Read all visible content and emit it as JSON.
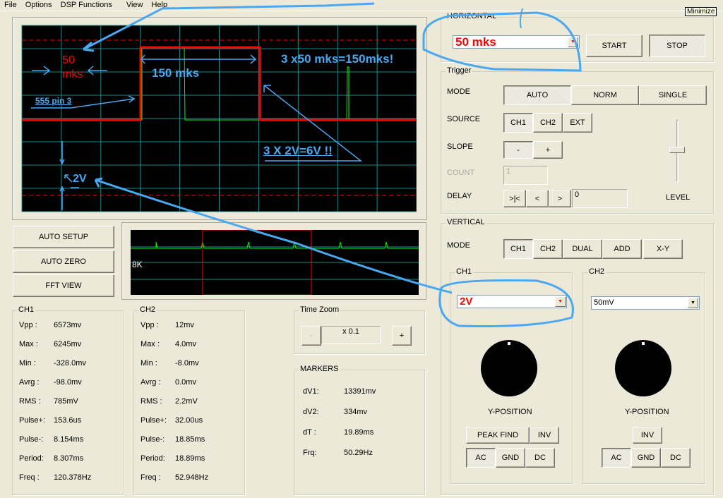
{
  "menu": [
    "File",
    "Options",
    "DSP Functions",
    "View",
    "Help"
  ],
  "tooltip": "Minimize",
  "horizontal": {
    "title": "HORIZONTAL",
    "timebase": "50 mks",
    "start": "START",
    "stop": "STOP"
  },
  "trigger": {
    "title": "Trigger",
    "mode_label": "MODE",
    "modes": [
      "AUTO",
      "NORM",
      "SINGLE"
    ],
    "source_label": "SOURCE",
    "sources": [
      "CH1",
      "CH2",
      "EXT"
    ],
    "slope_label": "SLOPE",
    "slopes": [
      "-",
      "+"
    ],
    "count_label": "COUNT",
    "count_value": "1",
    "delay_label": "DELAY",
    "delay_buttons": [
      ">|<",
      "<",
      ">"
    ],
    "delay_value": "0",
    "level_label": "LEVEL"
  },
  "vertical": {
    "title": "VERTICAL",
    "mode_label": "MODE",
    "modes": [
      "CH1",
      "CH2",
      "DUAL",
      "ADD",
      "X-Y"
    ],
    "ch1": {
      "title": "CH1",
      "volts": "2V",
      "ypos": "Y-POSITION",
      "peak": "PEAK FIND",
      "inv": "INV",
      "coupling": [
        "AC",
        "GND",
        "DC"
      ]
    },
    "ch2": {
      "title": "CH2",
      "volts": "50mV",
      "ypos": "Y-POSITION",
      "inv": "INV",
      "coupling": [
        "AC",
        "GND",
        "DC"
      ]
    }
  },
  "left_buttons": [
    "AUTO SETUP",
    "AUTO ZERO",
    "FFT  VIEW"
  ],
  "overview": {
    "label": "8K"
  },
  "ch1_meas": {
    "title": "CH1",
    "rows": [
      [
        "Vpp :",
        "6573mv"
      ],
      [
        "Max :",
        "6245mv"
      ],
      [
        "Min :",
        "-328.0mv"
      ],
      [
        "Avrg :",
        "-98.0mv"
      ],
      [
        "RMS :",
        "785mV"
      ],
      [
        "Pulse+:",
        "153.6us"
      ],
      [
        "Pulse-:",
        "8.154ms"
      ],
      [
        "Period:",
        "8.307ms"
      ],
      [
        "Freq :",
        "120.378Hz"
      ]
    ]
  },
  "ch2_meas": {
    "title": "CH2",
    "rows": [
      [
        "Vpp :",
        "12mv"
      ],
      [
        "Max :",
        "4.0mv"
      ],
      [
        "Min :",
        "-8.0mv"
      ],
      [
        "Avrg :",
        "0.0mv"
      ],
      [
        "RMS :",
        "2.2mV"
      ],
      [
        "Pulse+:",
        "32.00us"
      ],
      [
        "Pulse-:",
        "18.85ms"
      ],
      [
        "Period:",
        "18.89ms"
      ],
      [
        "Freq :",
        "52.948Hz"
      ]
    ]
  },
  "time_zoom": {
    "title": "Time Zoom",
    "minus": "-",
    "value": "x 0.1",
    "plus": "+"
  },
  "markers": {
    "title": "MARKERS",
    "rows": [
      [
        "dV1:",
        "13391mv"
      ],
      [
        "dV2:",
        "334mv"
      ],
      [
        "dT :",
        "19.89ms"
      ],
      [
        "Frq:",
        "50.29Hz"
      ]
    ]
  },
  "annotations": {
    "a50": "50",
    "amks": "mks",
    "a150": "150 mks",
    "formula": "3 x50 mks=150mks!",
    "pin": "555 pin 3",
    "volts": "3 X 2V=6V !!",
    "v2": "2V",
    "horiz_note": "!"
  },
  "colors": {
    "grid": "#1a8a8a",
    "trace": "#00ff00",
    "red": "#ff0000",
    "annot": "#4aa8f0"
  }
}
